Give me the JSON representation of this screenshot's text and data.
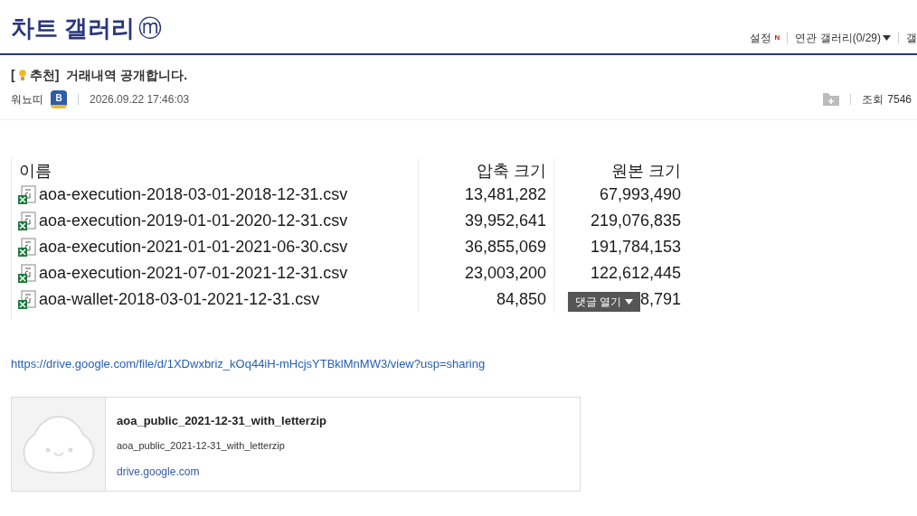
{
  "gallery": {
    "title": "차트 갤러리",
    "badge": "ⓜ"
  },
  "top_links": [
    {
      "label": "설정",
      "new_mark": "N",
      "caret": false
    },
    {
      "label": "연관 갤러리(0/29)",
      "caret": true
    },
    {
      "label": "갤",
      "caret": false
    }
  ],
  "post": {
    "title_prefix": "[",
    "title_tag": "추천]",
    "title": "거래내역 공개합니다.",
    "author": "워뇨띠",
    "author_badge": "B",
    "date": "2026.09.22 17:46:03",
    "views_label": "조회",
    "views": "7546"
  },
  "file_table": {
    "columns": [
      "이름",
      "압축 크기",
      "원본 크기"
    ],
    "rows": [
      {
        "name": "aoa-execution-2018-03-01-2018-12-31.csv",
        "compressed": "13,481,282",
        "original": "67,993,490"
      },
      {
        "name": "aoa-execution-2019-01-01-2020-12-31.csv",
        "compressed": "39,952,641",
        "original": "219,076,835"
      },
      {
        "name": "aoa-execution-2021-01-01-2021-06-30.csv",
        "compressed": "36,855,069",
        "original": "191,784,153"
      },
      {
        "name": "aoa-execution-2021-07-01-2021-12-31.csv",
        "compressed": "23,003,200",
        "original": "122,612,445"
      },
      {
        "name": "aoa-wallet-2018-03-01-2021-12-31.csv",
        "compressed": "84,850",
        "original": "8,791"
      }
    ]
  },
  "comment_toggle": {
    "label": "댓글 열기"
  },
  "link": "https://drive.google.com/file/d/1XDwxbriz_kOq44iH-mHcjsYTBklMnMW3/view?usp=sharing",
  "link_card": {
    "title": "aoa_public_2021-12-31_with_letterzip",
    "description": "aoa_public_2021-12-31_with_letterzip",
    "domain": "drive.google.com"
  }
}
